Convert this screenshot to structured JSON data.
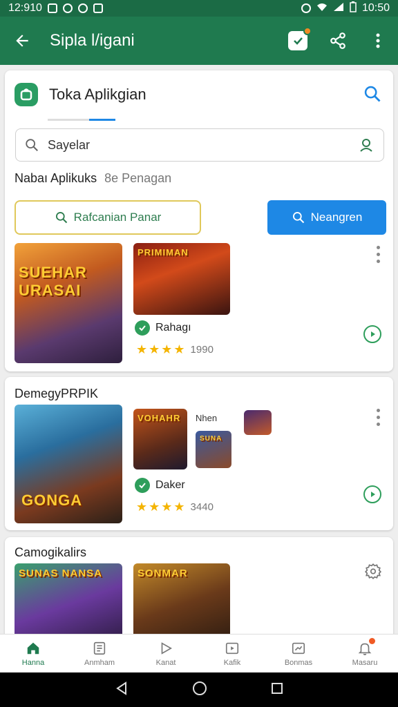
{
  "status_bar": {
    "time_left": "12:910",
    "time_right": "10:50"
  },
  "app_bar": {
    "title": "Sipla l/igani"
  },
  "store": {
    "title": "Toka Aplikgian",
    "search_placeholder": "Sayelar",
    "section_title": "Nabaı Aplikuks",
    "section_sub": "8e Penagan",
    "btn_outline_label": "Rafcanian Panar",
    "btn_fill_label": "Neangren",
    "apps": [
      {
        "cover_text": "SUEHAR URASAI",
        "thumb_text": "PRIMIMAN",
        "name": "Rahagı",
        "stars": "★★★★",
        "count": "1990"
      }
    ]
  },
  "section2": {
    "title": "DemegyPRPIK",
    "cover_text": "GONGA",
    "thumb_text": "VOHAHR",
    "thumb2_text": "SUNA",
    "label_small": "Nhen",
    "name": "Daker",
    "stars": "★★★★",
    "count": "3440"
  },
  "section3": {
    "title": "Camogikalirs",
    "cover_text": "SUNAS NANSA",
    "thumb_text": "SONMAR"
  },
  "bottom_nav": [
    {
      "label": "Hanna",
      "icon": "home-icon"
    },
    {
      "label": "Anmham",
      "icon": "list-icon"
    },
    {
      "label": "Kanat",
      "icon": "play-icon"
    },
    {
      "label": "Kafik",
      "icon": "video-icon"
    },
    {
      "label": "Bonmas",
      "icon": "trending-icon"
    },
    {
      "label": "Masaru",
      "icon": "notification-icon"
    }
  ],
  "colors": {
    "primary": "#1f7a4f",
    "accent": "#1e88e5",
    "star": "#f4b400"
  }
}
